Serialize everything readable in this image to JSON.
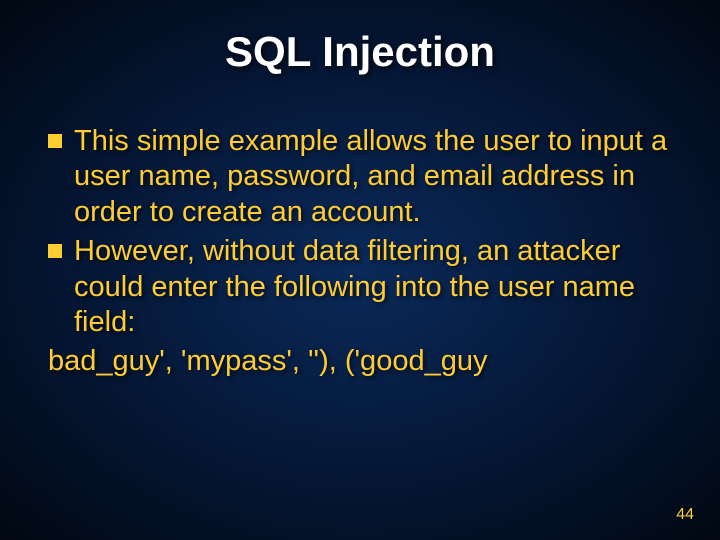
{
  "slide": {
    "title": "SQL Injection",
    "bullets": [
      "This simple example allows the user to input a user name, password, and email address in order to create an account.",
      "However, without data filtering, an attacker could enter the following into the user name field:"
    ],
    "code_line": "bad_guy', 'mypass', ''), ('good_guy",
    "page_number": "44"
  }
}
